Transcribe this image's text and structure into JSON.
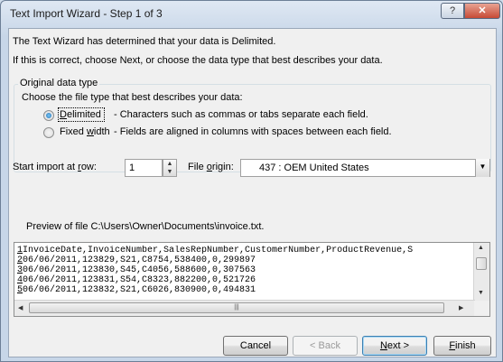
{
  "window": {
    "title": "Text Import Wizard - Step 1 of 3",
    "help_label": "?",
    "close_label": "✕"
  },
  "intro": {
    "line1": "The Text Wizard has determined that your data is Delimited.",
    "line2": "If this is correct, choose Next, or choose the data type that best describes your data."
  },
  "original_data_type": {
    "title": "Original data type",
    "prompt": "Choose the file type that best describes your data:",
    "options": [
      {
        "label": "Delimited",
        "description": "- Characters such as commas or tabs separate each field.",
        "checked": true
      },
      {
        "label": "Fixed width",
        "description": "- Fields are aligned in columns with spaces between each field.",
        "checked": false
      }
    ]
  },
  "start_import": {
    "label": "Start import at row:",
    "value": "1"
  },
  "file_origin": {
    "label": "File origin:",
    "value": "437 : OEM United States"
  },
  "preview": {
    "label": "Preview of file C:\\Users\\Owner\\Documents\\invoice.txt.",
    "lines": [
      {
        "num": "1",
        "text": "InvoiceDate,InvoiceNumber,SalesRepNumber,CustomerNumber,ProductRevenue,S"
      },
      {
        "num": "2",
        "text": "06/06/2011,123829,S21,C8754,538400,0,299897"
      },
      {
        "num": "3",
        "text": "06/06/2011,123830,S45,C4056,588600,0,307563"
      },
      {
        "num": "4",
        "text": "06/06/2011,123831,S54,C8323,882200,0,521726"
      },
      {
        "num": "5",
        "text": "06/06/2011,123832,S21,C6026,830900,0,494831"
      }
    ]
  },
  "buttons": {
    "cancel": "Cancel",
    "back": "< Back",
    "next": "Next >",
    "finish": "Finish"
  }
}
